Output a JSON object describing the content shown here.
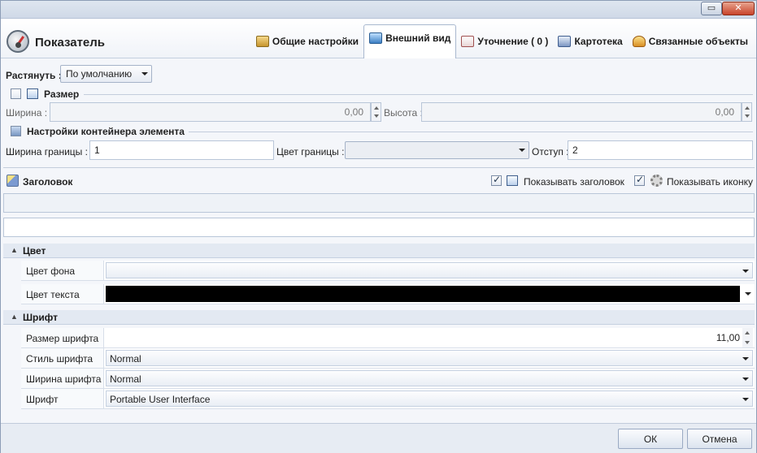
{
  "window": {
    "title": "Показатель",
    "restore_glyph": "▭",
    "close_glyph": "✕"
  },
  "tabs": [
    {
      "label": "Общие настройки",
      "icon": "settings-icon"
    },
    {
      "label": "Внешний вид",
      "icon": "appearance-icon",
      "active": true
    },
    {
      "label": "Уточнение ( 0 )",
      "icon": "refine-icon"
    },
    {
      "label": "Картотека",
      "icon": "card-index-icon"
    },
    {
      "label": "Связанные объекты",
      "icon": "linked-objects-icon"
    }
  ],
  "stretch": {
    "label": "Растянуть :",
    "value": "По умолчанию"
  },
  "size": {
    "title": "Размер",
    "checked": false,
    "width_label": "Ширина :",
    "width_value": "0,00",
    "height_label": "Высота :",
    "height_value": "0,00"
  },
  "container": {
    "title": "Настройки контейнера элемента",
    "checked": false,
    "border_width_label": "Ширина границы :",
    "border_width_value": "1",
    "border_color_label": "Цвет границы :",
    "border_color_value": "",
    "padding_label": "Отступ :",
    "padding_value": "2"
  },
  "header_section": {
    "title": "Заголовок",
    "show_header_label": "Показывать заголовок",
    "show_header_checked": true,
    "show_icon_label": "Показывать иконку",
    "show_icon_checked": true,
    "header_text": "",
    "search_value": ""
  },
  "property_groups": [
    {
      "name": "Цвет",
      "rows": [
        {
          "label": "Цвет фона",
          "value": "",
          "kind": "dropdown"
        },
        {
          "label": "Цвет текста",
          "value": "",
          "kind": "color",
          "color": "#000000"
        }
      ]
    },
    {
      "name": "Шрифт",
      "rows": [
        {
          "label": "Размер шрифта",
          "value": "11,00",
          "kind": "number"
        },
        {
          "label": "Стиль шрифта",
          "value": "Normal",
          "kind": "dropdown"
        },
        {
          "label": "Ширина шрифта",
          "value": "Normal",
          "kind": "dropdown"
        },
        {
          "label": "Шрифт",
          "value": "Portable User Interface",
          "kind": "dropdown"
        }
      ]
    }
  ],
  "footer": {
    "ok_label": "ОК",
    "cancel_label": "Отмена"
  },
  "colors": {
    "accent": "#3c7fc4",
    "text_color_swatch": "#000000"
  }
}
